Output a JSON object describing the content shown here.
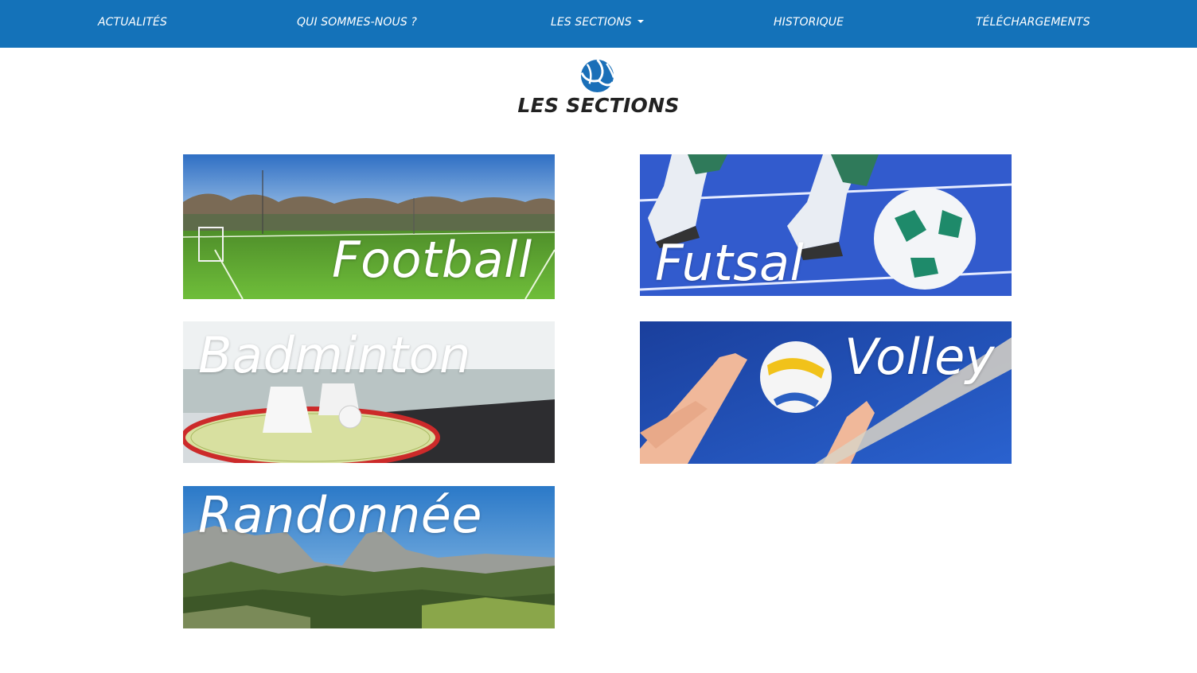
{
  "nav": {
    "items": [
      {
        "label": "ACTUALITÉS"
      },
      {
        "label": "QUI SOMMES-NOUS ?"
      },
      {
        "label": "LES SECTIONS"
      },
      {
        "label": "HISTORIQUE"
      },
      {
        "label": "TÉLÉCHARGEMENTS"
      }
    ],
    "dropdown_icon": "caret-down-icon"
  },
  "header": {
    "logo_icon": "volleyball-icon",
    "title": "LES SECTIONS"
  },
  "sections": [
    {
      "label": "Football"
    },
    {
      "label": "Futsal"
    },
    {
      "label": "Badminton"
    },
    {
      "label": "Volley"
    },
    {
      "label": "Randonnée"
    }
  ],
  "colors": {
    "nav_background": "#1472b9",
    "nav_text": "#ffffff",
    "title_text": "#222222",
    "logo": "#1a6fb8"
  }
}
